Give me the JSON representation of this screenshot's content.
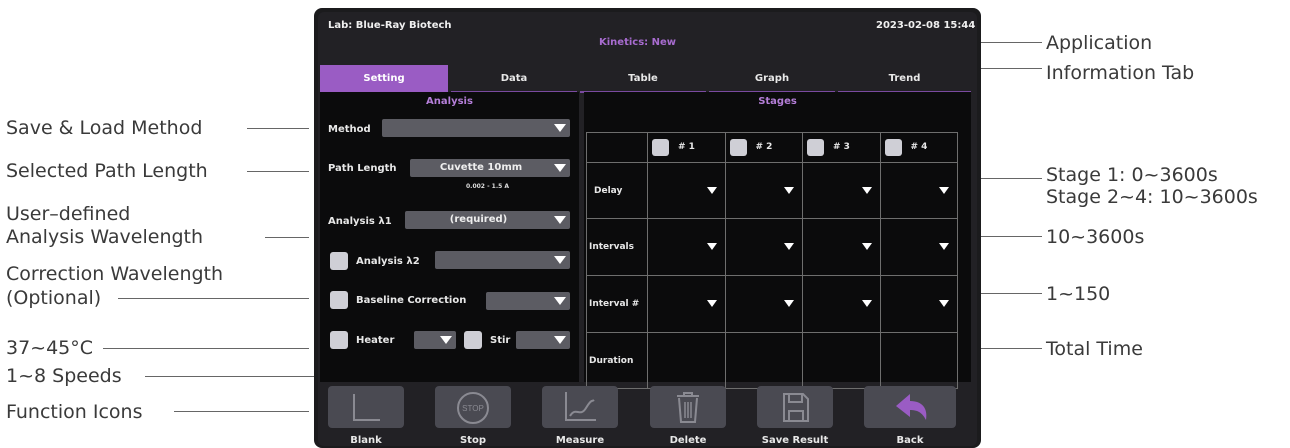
{
  "header": {
    "lab": "Lab: Blue-Ray Biotech",
    "datetime": "2023-02-08 15:44",
    "application": "Kinetics: New"
  },
  "tabs": [
    "Setting",
    "Data",
    "Table",
    "Graph",
    "Trend"
  ],
  "analysis": {
    "title": "Analysis",
    "method_label": "Method",
    "path_label": "Path Length",
    "path_value": "Cuvette 10mm",
    "path_range": "0.002 - 1.5 A",
    "lambda1_label": "Analysis λ1",
    "lambda1_value": "(required)",
    "lambda2_label": "Analysis λ2",
    "baseline_label": "Baseline Correction",
    "heater_label": "Heater",
    "stir_label": "Stir"
  },
  "stages": {
    "title": "Stages",
    "columns": [
      "# 1",
      "# 2",
      "# 3",
      "# 4"
    ],
    "rows": [
      "Delay",
      "Intervals",
      "Interval #",
      "Duration"
    ]
  },
  "functions": [
    "Blank",
    "Stop",
    "Measure",
    "Delete",
    "Save Result",
    "Back"
  ],
  "function_icons": [
    "blank-icon",
    "stop-icon",
    "measure-icon",
    "delete-icon",
    "save-icon",
    "back-icon"
  ],
  "stop_icon_text": "STOP",
  "annotations": {
    "left": [
      "Save & Load Method",
      "Selected Path Length",
      "User–defined",
      "Analysis Wavelength",
      "Correction Wavelength",
      "(Optional)",
      "37~45°C",
      "1~8 Speeds",
      "Function Icons"
    ],
    "right": [
      "Application",
      "Information Tab",
      "Stage 1: 0~3600s",
      "Stage 2~4: 10~3600s",
      "10~3600s",
      "1~150",
      "Total Time"
    ]
  },
  "colors": {
    "accent": "#9a5cc4",
    "accent_text": "#b47ed8",
    "panel": "#0b0b0c",
    "screen": "#222125"
  }
}
